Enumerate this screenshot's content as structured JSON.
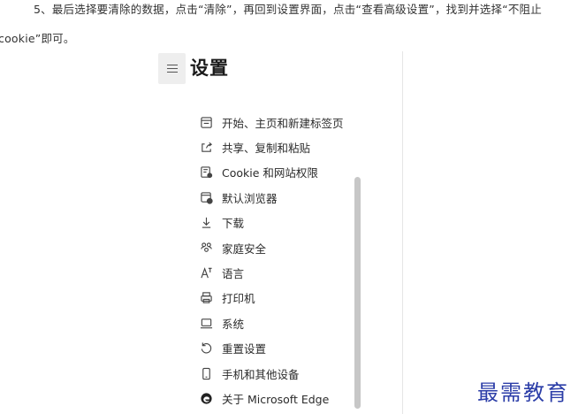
{
  "article": {
    "line1": "5、最后选择要清除的数据，点击“清除”，再回到设置界面，点击“查看高级设置”，找到并选择“不阻止",
    "line2": "cookie”即可。"
  },
  "settings": {
    "title": "设置",
    "menu_icon": "hamburger-icon",
    "nav_items": [
      {
        "label": "开始、主页和新建标签页",
        "icon": "start-page-icon"
      },
      {
        "label": "共享、复制和粘贴",
        "icon": "share-icon"
      },
      {
        "label": "Cookie 和网站权限",
        "icon": "cookie-permissions-icon"
      },
      {
        "label": "默认浏览器",
        "icon": "default-browser-icon"
      },
      {
        "label": "下载",
        "icon": "download-icon"
      },
      {
        "label": "家庭安全",
        "icon": "family-icon"
      },
      {
        "label": "语言",
        "icon": "language-icon"
      },
      {
        "label": "打印机",
        "icon": "printer-icon"
      },
      {
        "label": "系统",
        "icon": "system-icon"
      },
      {
        "label": "重置设置",
        "icon": "reset-icon"
      },
      {
        "label": "手机和其他设备",
        "icon": "phone-icon"
      },
      {
        "label": "关于 Microsoft Edge",
        "icon": "edge-icon"
      }
    ]
  },
  "watermark": "最需教育",
  "colors": {
    "watermark": "#2c3ea8",
    "scrollbar": "#c7c7c7",
    "menu_button_bg": "#eeeeee"
  }
}
